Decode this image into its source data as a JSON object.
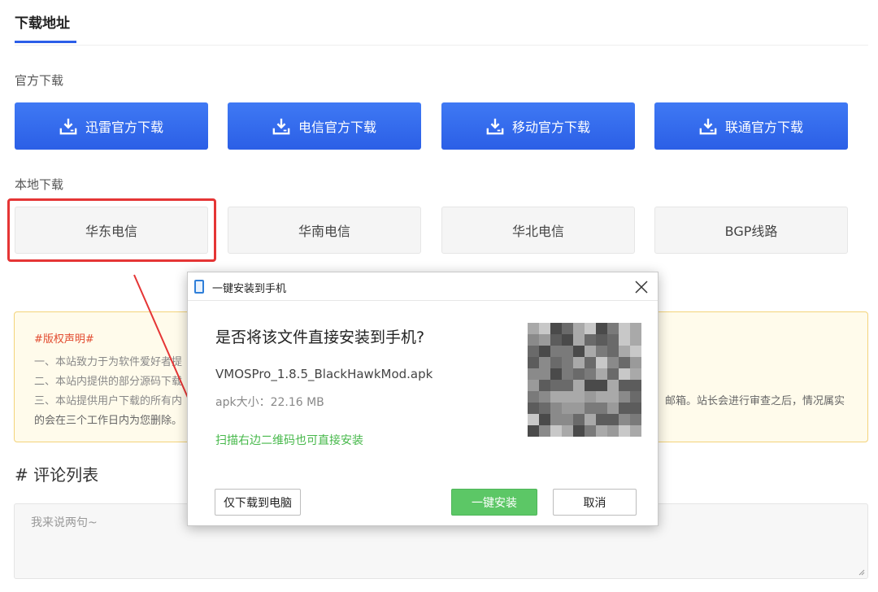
{
  "tab": {
    "title": "下载地址"
  },
  "official": {
    "label": "官方下载",
    "buttons": [
      {
        "label": "迅雷官方下载"
      },
      {
        "label": "电信官方下载"
      },
      {
        "label": "移动官方下载"
      },
      {
        "label": "联通官方下载"
      }
    ]
  },
  "local": {
    "label": "本地下载",
    "buttons": [
      {
        "label": "华东电信"
      },
      {
        "label": "华南电信"
      },
      {
        "label": "华北电信"
      },
      {
        "label": "BGP线路"
      }
    ]
  },
  "notice": {
    "title": "#版权声明#",
    "lines": [
      "一、本站致力于为软件爱好者提",
      "二、本站内提供的部分源码下载",
      "三、本站提供用户下载的所有内",
      "的会在三个工作日内为您删除。"
    ],
    "tail": "邮箱。站长会进行审查之后，情况属实"
  },
  "comments": {
    "title": "# 评论列表",
    "placeholder": "我来说两句~"
  },
  "dialog": {
    "title": "一键安装到手机",
    "heading": "是否将该文件直接安装到手机?",
    "filename": "VMOSPro_1.8.5_BlackHawkMod.apk",
    "size": "apk大小：22.16 MB",
    "hint": "扫描右边二维码也可直接安装",
    "btn_download_pc": "仅下载到电脑",
    "btn_install": "一键安装",
    "btn_cancel": "取消"
  },
  "colors": {
    "primary": "#2c5ee8",
    "highlight": "#e53535",
    "install_green": "#5cc766",
    "notice_bg": "#fffbeb"
  },
  "icons": {
    "download": "download-icon",
    "close": "close-icon",
    "phone": "phone-icon"
  }
}
